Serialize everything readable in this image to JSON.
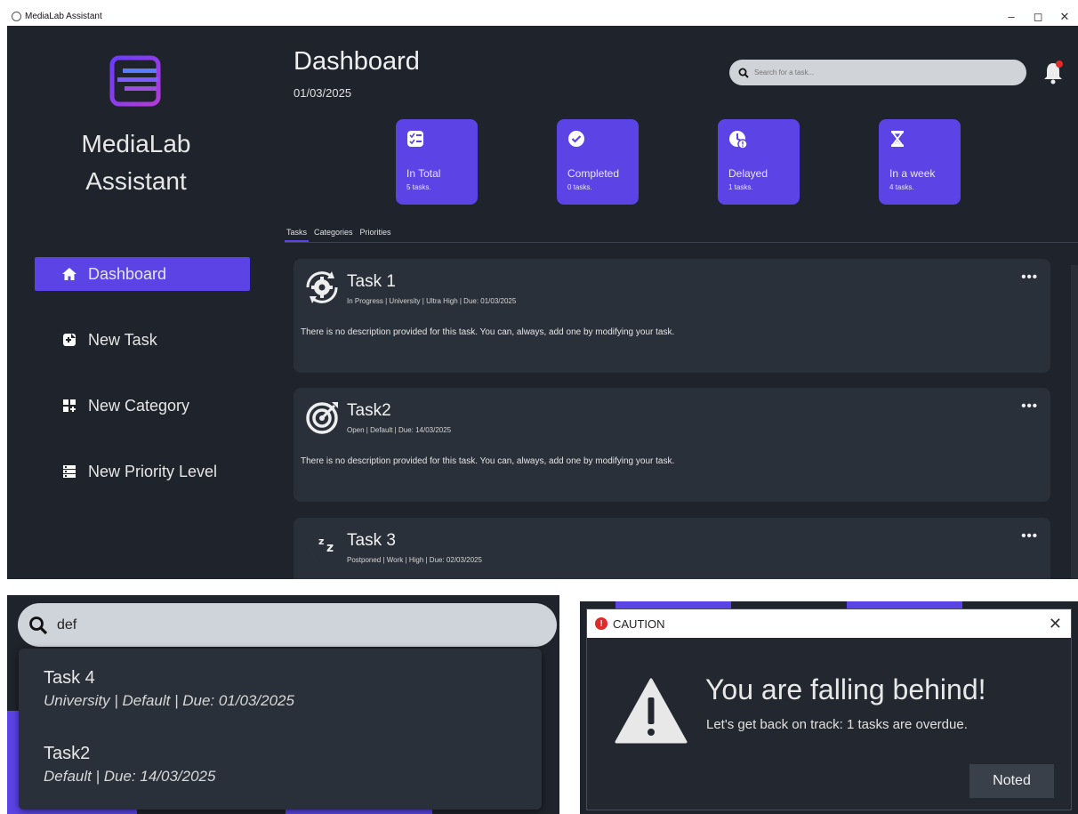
{
  "window": {
    "title": "MediaLab Assistant",
    "controls": [
      "–",
      "◻",
      "✕"
    ]
  },
  "sidebar": {
    "app_name_line1": "MediaLab",
    "app_name_line2": "Assistant",
    "items": [
      {
        "label": "Dashboard",
        "icon": "home-icon",
        "active": true
      },
      {
        "label": "New Task",
        "icon": "add-task-icon"
      },
      {
        "label": "New Category",
        "icon": "add-category-icon"
      },
      {
        "label": "New Priority Level",
        "icon": "priority-list-icon"
      }
    ]
  },
  "header": {
    "title": "Dashboard",
    "date": "01/03/2025",
    "search_placeholder": "Search for a task..."
  },
  "stats": [
    {
      "label": "In Total",
      "count": "5 tasks.",
      "icon": "checklist-icon"
    },
    {
      "label": "Completed",
      "count": "0 tasks.",
      "icon": "check-circle-icon"
    },
    {
      "label": "Delayed",
      "count": "1 tasks.",
      "icon": "clock-alert-icon"
    },
    {
      "label": "In a week",
      "count": "4 tasks.",
      "icon": "hourglass-icon"
    }
  ],
  "tabs": [
    "Tasks",
    "Categories",
    "Priorities"
  ],
  "tasks": [
    {
      "name": "Task 1",
      "meta": "In Progress | University | Ultra High | Due: 01/03/2025",
      "description": "There is no description provided for this task. You can, always, add one by modifying your task.",
      "icon": "gear-refresh-icon"
    },
    {
      "name": "Task2",
      "meta": "Open | Default | Due: 14/03/2025",
      "description": "There is no description provided for this task. You can, always, add one by modifying your task.",
      "icon": "target-icon"
    },
    {
      "name": "Task 3",
      "meta": "Postponed | Work | High | Due: 02/03/2025",
      "description": "",
      "icon": "sleep-moon-icon"
    }
  ],
  "more_label": "•••",
  "search_popup": {
    "query": "def",
    "results": [
      {
        "name": "Task 4",
        "meta": "University | Default | Due: 01/03/2025"
      },
      {
        "name": "Task2",
        "meta": "Default | Due: 14/03/2025"
      }
    ]
  },
  "caution_dialog": {
    "title": "CAUTION",
    "close": "✕",
    "heading": "You are falling behind!",
    "message": "Let's get back on track: 1 tasks are overdue.",
    "button": "Noted"
  },
  "colors": {
    "accent": "#5b43e6",
    "background": "#1f232b",
    "card": "#2a3039",
    "notification": "#e12a2a"
  }
}
